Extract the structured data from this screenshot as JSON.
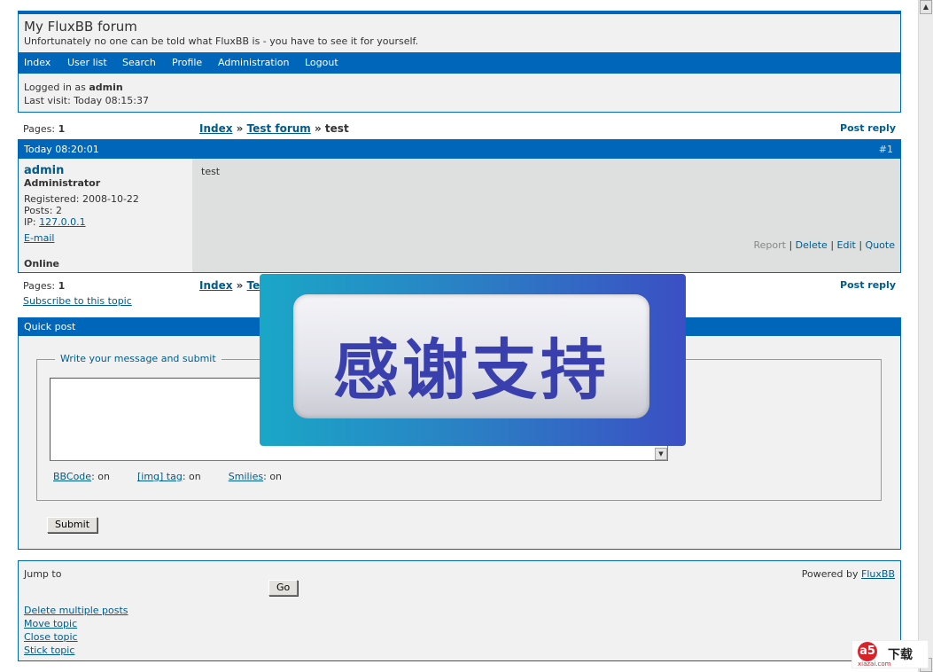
{
  "header": {
    "title": "My FluxBB forum",
    "description": "Unfortunately no one can be told what FluxBB is - you have to see it for yourself.",
    "nav": [
      "Index",
      "User list",
      "Search",
      "Profile",
      "Administration",
      "Logout"
    ],
    "logged_in_prefix": "Logged in as ",
    "logged_in_user": "admin",
    "last_visit": "Last visit: Today 08:15:37"
  },
  "pagination": {
    "label": "Pages: ",
    "page": "1",
    "crumb_index": "Index",
    "crumb_sep": " » ",
    "crumb_forum": "Test forum",
    "crumb_topic": "test",
    "post_reply": "Post reply",
    "crumb_forum_visible_bottom": "Te"
  },
  "post": {
    "date": "Today 08:20:01",
    "number": "#1",
    "author": "admin",
    "author_title": "Administrator",
    "registered": "Registered: 2008-10-22",
    "posts": "Posts: 2",
    "ip_label": "IP: ",
    "ip": "127.0.0.1",
    "email": "E-mail",
    "online": "Online",
    "message": "test",
    "actions": {
      "report": "Report",
      "delete": "Delete",
      "edit": "Edit",
      "quote": "Quote",
      "sep": " | "
    }
  },
  "subscribe": "Subscribe to this topic",
  "quick_post": {
    "title": "Quick post",
    "legend": "Write your message and submit",
    "bbcode": "BBCode",
    "img_tag": "[img] tag",
    "smilies": "Smilies",
    "on_suffix": ": on",
    "submit": "Submit"
  },
  "footer": {
    "jump_to": "Jump to",
    "go": "Go",
    "powered_prefix": "Powered by ",
    "powered_link": "FluxBB",
    "mod_links": [
      "Delete multiple posts",
      "Move topic",
      "Close topic",
      "Stick topic"
    ]
  },
  "overlay": {
    "text": "感谢支持"
  },
  "watermark": {
    "brand_letter": "a5",
    "brand_cn": "下载",
    "brand_url": "xiazai.com"
  },
  "colors": {
    "accent": "#0066b9",
    "link": "#005b8c",
    "post_body": "#dedfdf"
  }
}
